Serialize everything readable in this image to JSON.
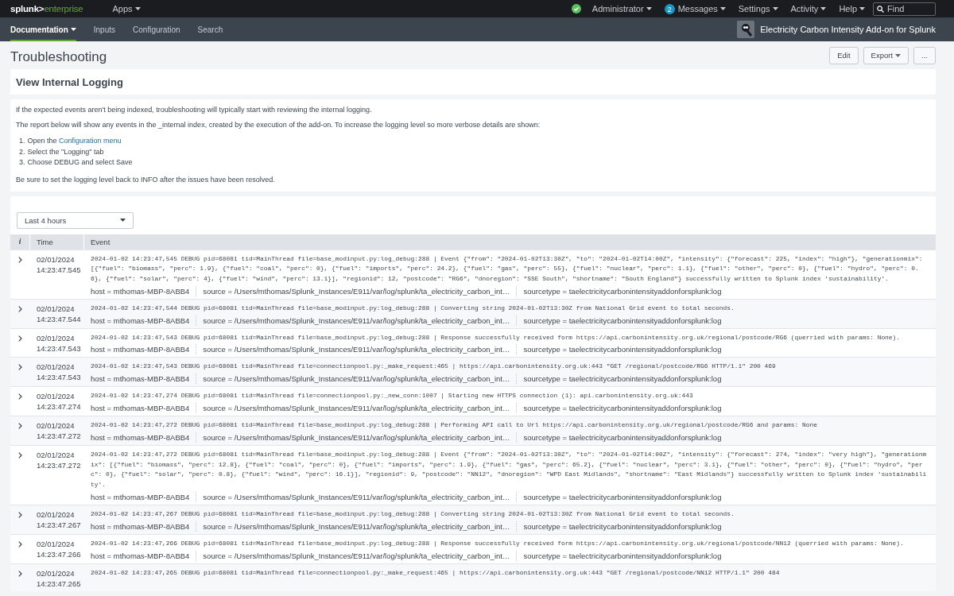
{
  "top_bar": {
    "logo_brand": "splunk>",
    "logo_product": "enterprise",
    "menus": [
      {
        "label": "Apps",
        "kind": "menu"
      },
      {
        "label": "Administrator",
        "kind": "status"
      },
      {
        "label": "Messages",
        "kind": "badge",
        "badge": "2"
      },
      {
        "label": "Settings",
        "kind": "menu"
      },
      {
        "label": "Activity",
        "kind": "menu"
      },
      {
        "label": "Help",
        "kind": "menu"
      }
    ],
    "search": {
      "placeholder": "Find"
    }
  },
  "app_bar": {
    "items": [
      {
        "label": "Documentation",
        "selected": true,
        "dropdown": true
      },
      {
        "label": "Inputs",
        "selected": false,
        "dropdown": false
      },
      {
        "label": "Configuration",
        "selected": false,
        "dropdown": false
      },
      {
        "label": "Search",
        "selected": false,
        "dropdown": false
      }
    ],
    "app_title": "Electricity Carbon Intensity Add-on for Splunk"
  },
  "page": {
    "title": "Troubleshooting",
    "buttons": [
      {
        "label": "Edit",
        "dropdown": false
      },
      {
        "label": "Export",
        "dropdown": true
      },
      {
        "label": "...",
        "dropdown": false
      }
    ]
  },
  "panels": [
    {
      "title": "View Internal Logging"
    }
  ],
  "help_text": {
    "intro": "If the expected events aren't being indexed, troubleshooting will typically start with reviewing the internal logging.",
    "report": "The report below will show any events in the _internal index, created by the execution of the add-on. To increase the logging level so more verbose details are shown:",
    "steps": [
      {
        "number": "1.",
        "text": "Open the ",
        "link": "Configuration menu"
      },
      {
        "number": "2.",
        "text": "Select the \"Logging\" tab"
      },
      {
        "number": "3.",
        "text": "Choose DEBUG and select Save"
      }
    ],
    "closing": "Be sure to set the logging level back to INFO after the issues have been resolved."
  },
  "time_picker": {
    "value": "Last 4 hours"
  },
  "table": {
    "columns": [
      "i",
      "Time",
      "Event"
    ],
    "rows": [
      {
        "date": "02/01/2024",
        "time": "14:23:47.545",
        "event": "2024-01-02 14:23:47,545 DEBUG pid=68081 tid=MainThread file=base_modinput.py:log_debug:288 | Event {\"from\": \"2024-01-02T13:30Z\", \"to\": \"2024-01-02T14:00Z\", \"intensity\": {\"forecast\": 225, \"index\": \"high\"}, \"generationmix\": [{\"fuel\": \"biomass\", \"perc\": 1.9}, {\"fuel\": \"coal\", \"perc\": 0}, {\"fuel\": \"imports\", \"perc\": 24.2}, {\"fuel\": \"gas\", \"perc\": 55}, {\"fuel\": \"nuclear\", \"perc\": 1.1}, {\"fuel\": \"other\", \"perc\": 0}, {\"fuel\": \"hydro\", \"perc\": 0.6}, {\"fuel\": \"solar\", \"perc\": 4}, {\"fuel\": \"wind\", \"perc\": 13.1}], \"regionid\": 12, \"postcode\": \"RG6\", \"dnoregion\": \"SSE South\", \"shortname\": \"South England\"} successfully written to Splunk index 'sustainability'.",
        "fields": [
          "host = mthomas-MBP-8ABB4",
          "source = /Users/mthomas/Splunk_Instances/E911/var/log/splunk/ta_electricity_carbon_int…",
          "sourcetype = taelectricitycarbonintensityaddonforsplunk:log"
        ]
      },
      {
        "date": "02/01/2024",
        "time": "14:23:47.544",
        "event": "2024-01-02 14:23:47,544 DEBUG pid=68081 tid=MainThread file=base_modinput.py:log_debug:288 | Converting string 2024-01-02T13:30Z from National Grid event to total seconds.",
        "fields": [
          "host = mthomas-MBP-8ABB4",
          "source = /Users/mthomas/Splunk_Instances/E911/var/log/splunk/ta_electricity_carbon_int…",
          "sourcetype = taelectricitycarbonintensityaddonforsplunk:log"
        ]
      },
      {
        "date": "02/01/2024",
        "time": "14:23:47.543",
        "event": "2024-01-02 14:23:47,543 DEBUG pid=68081 tid=MainThread file=base_modinput.py:log_debug:288 | Response successfully received form https://api.carbonintensity.org.uk/regional/postcode/RG6 (querried with params: None).",
        "fields": [
          "host = mthomas-MBP-8ABB4",
          "source = /Users/mthomas/Splunk_Instances/E911/var/log/splunk/ta_electricity_carbon_int…",
          "sourcetype = taelectricitycarbonintensityaddonforsplunk:log"
        ]
      },
      {
        "date": "02/01/2024",
        "time": "14:23:47.543",
        "event": "2024-01-02 14:23:47,543 DEBUG pid=68081 tid=MainThread file=connectionpool.py:_make_request:465 | https://api.carbonintensity.org.uk:443 \"GET /regional/postcode/RG6 HTTP/1.1\" 200 469",
        "fields": [
          "host = mthomas-MBP-8ABB4",
          "source = /Users/mthomas/Splunk_Instances/E911/var/log/splunk/ta_electricity_carbon_int…",
          "sourcetype = taelectricitycarbonintensityaddonforsplunk:log"
        ]
      },
      {
        "date": "02/01/2024",
        "time": "14:23:47.274",
        "event": "2024-01-02 14:23:47,274 DEBUG pid=68081 tid=MainThread file=connectionpool.py:_new_conn:1007 | Starting new HTTPS connection (1): api.carbonintensity.org.uk:443",
        "fields": [
          "host = mthomas-MBP-8ABB4",
          "source = /Users/mthomas/Splunk_Instances/E911/var/log/splunk/ta_electricity_carbon_int…",
          "sourcetype = taelectricitycarbonintensityaddonforsplunk:log"
        ]
      },
      {
        "date": "02/01/2024",
        "time": "14:23:47.272",
        "event": "2024-01-02 14:23:47,272 DEBUG pid=68081 tid=MainThread file=base_modinput.py:log_debug:288 | Performing API call to Url https://api.carbonintensity.org.uk/regional/postcode/RG6 and params: None",
        "fields": [
          "host = mthomas-MBP-8ABB4",
          "source = /Users/mthomas/Splunk_Instances/E911/var/log/splunk/ta_electricity_carbon_int…",
          "sourcetype = taelectricitycarbonintensityaddonforsplunk:log"
        ]
      },
      {
        "date": "02/01/2024",
        "time": "14:23:47.272",
        "event": "2024-01-02 14:23:47,272 DEBUG pid=68081 tid=MainThread file=base_modinput.py:log_debug:288 | Event {\"from\": \"2024-01-02T13:30Z\", \"to\": \"2024-01-02T14:00Z\", \"intensity\": {\"forecast\": 274, \"index\": \"very high\"}, \"generationmix\": [{\"fuel\": \"biomass\", \"perc\": 12.8}, {\"fuel\": \"coal\", \"perc\": 0}, {\"fuel\": \"imports\", \"perc\": 1.9}, {\"fuel\": \"gas\", \"perc\": 65.2}, {\"fuel\": \"nuclear\", \"perc\": 3.1}, {\"fuel\": \"other\", \"perc\": 0}, {\"fuel\": \"hydro\", \"perc\": 0}, {\"fuel\": \"solar\", \"perc\": 0.8}, {\"fuel\": \"wind\", \"perc\": 16.1}], \"regionid\": 9, \"postcode\": \"NN12\", \"dnoregion\": \"WPD East Midlands\", \"shortname\": \"East Midlands\"} successfully written to Splunk index 'sustainability'.",
        "fields": [
          "host = mthomas-MBP-8ABB4",
          "source = /Users/mthomas/Splunk_Instances/E911/var/log/splunk/ta_electricity_carbon_int…",
          "sourcetype = taelectricitycarbonintensityaddonforsplunk:log"
        ]
      },
      {
        "date": "02/01/2024",
        "time": "14:23:47.267",
        "event": "2024-01-02 14:23:47,267 DEBUG pid=68081 tid=MainThread file=base_modinput.py:log_debug:288 | Converting string 2024-01-02T13:30Z from National Grid event to total seconds.",
        "fields": [
          "host = mthomas-MBP-8ABB4",
          "source = /Users/mthomas/Splunk_Instances/E911/var/log/splunk/ta_electricity_carbon_int…",
          "sourcetype = taelectricitycarbonintensityaddonforsplunk:log"
        ]
      },
      {
        "date": "02/01/2024",
        "time": "14:23:47.266",
        "event": "2024-01-02 14:23:47,266 DEBUG pid=68081 tid=MainThread file=base_modinput.py:log_debug:288 | Response successfully received form https://api.carbonintensity.org.uk/regional/postcode/NN12 (querried with params: None).",
        "fields": [
          "host = mthomas-MBP-8ABB4",
          "source = /Users/mthomas/Splunk_Instances/E911/var/log/splunk/ta_electricity_carbon_int…",
          "sourcetype = taelectricitycarbonintensityaddonforsplunk:log"
        ]
      },
      {
        "date": "02/01/2024",
        "time": "14:23:47.265",
        "event": "2024-01-02 14:23:47,265 DEBUG pid=68081 tid=MainThread file=connectionpool.py:_make_request:465 | https://api.carbonintensity.org.uk:443 \"GET /regional/postcode/NN12 HTTP/1.1\" 200 484"
      }
    ]
  }
}
